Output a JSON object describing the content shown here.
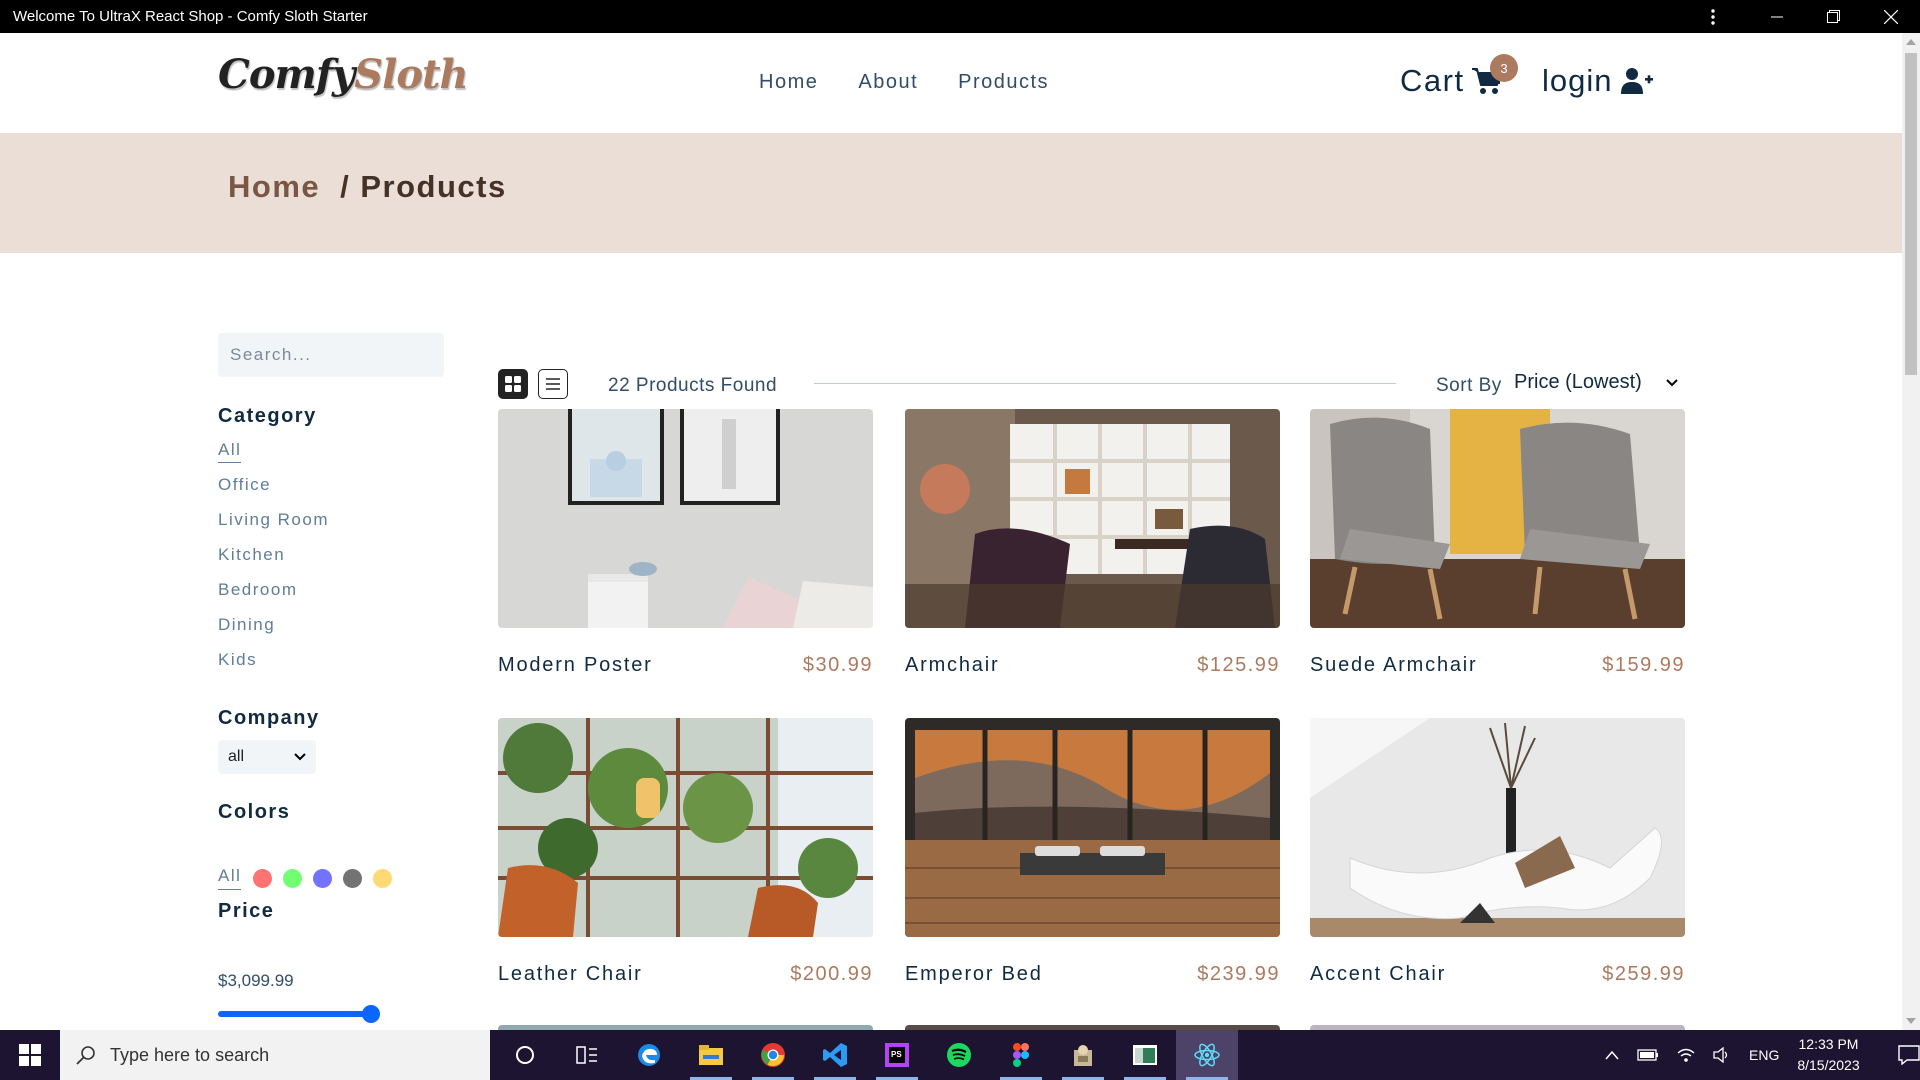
{
  "window": {
    "title": "Welcome To UltraX React Shop - Comfy Sloth Starter"
  },
  "nav": {
    "logo_part1": "Comfy",
    "logo_part2": "Sloth",
    "links": [
      "Home",
      "About",
      "Products"
    ],
    "cart_label": "Cart",
    "cart_count": "3",
    "login_label": "login"
  },
  "hero": {
    "crumb_home": "Home",
    "crumb_current": "/ Products"
  },
  "filters": {
    "search_placeholder": "Search...",
    "category_heading": "Category",
    "categories": [
      "All",
      "Office",
      "Living Room",
      "Kitchen",
      "Bedroom",
      "Dining",
      "Kids"
    ],
    "company_heading": "Company",
    "company_value": "all",
    "colors_heading": "Colors",
    "colors_all": "All",
    "color_swatches": [
      "#ff0000",
      "#00ff00",
      "#0000ff",
      "#000000",
      "#ffb900"
    ],
    "price_heading": "Price",
    "price_value": "$3,099.99",
    "price_slider_fraction": 1.0
  },
  "sortbar": {
    "count_text": "22 Products Found",
    "sort_label": "Sort By",
    "sort_value": "Price (Lowest)"
  },
  "products": [
    {
      "name": "Modern Poster",
      "price": "$30.99"
    },
    {
      "name": "Armchair",
      "price": "$125.99"
    },
    {
      "name": "Suede Armchair",
      "price": "$159.99"
    },
    {
      "name": "Leather Chair",
      "price": "$200.99"
    },
    {
      "name": "Emperor Bed",
      "price": "$239.99"
    },
    {
      "name": "Accent Chair",
      "price": "$259.99"
    }
  ],
  "taskbar": {
    "search_placeholder": "Type here to search",
    "language": "ENG",
    "time": "12:33 PM",
    "date": "8/15/2023",
    "apps": [
      "task-view-icon",
      "edge-icon",
      "file-explorer-icon",
      "chrome-icon",
      "vscode-icon",
      "phpstorm-icon",
      "spotify-icon",
      "figma-icon",
      "app-icon",
      "terminal-icon",
      "react-icon"
    ]
  }
}
